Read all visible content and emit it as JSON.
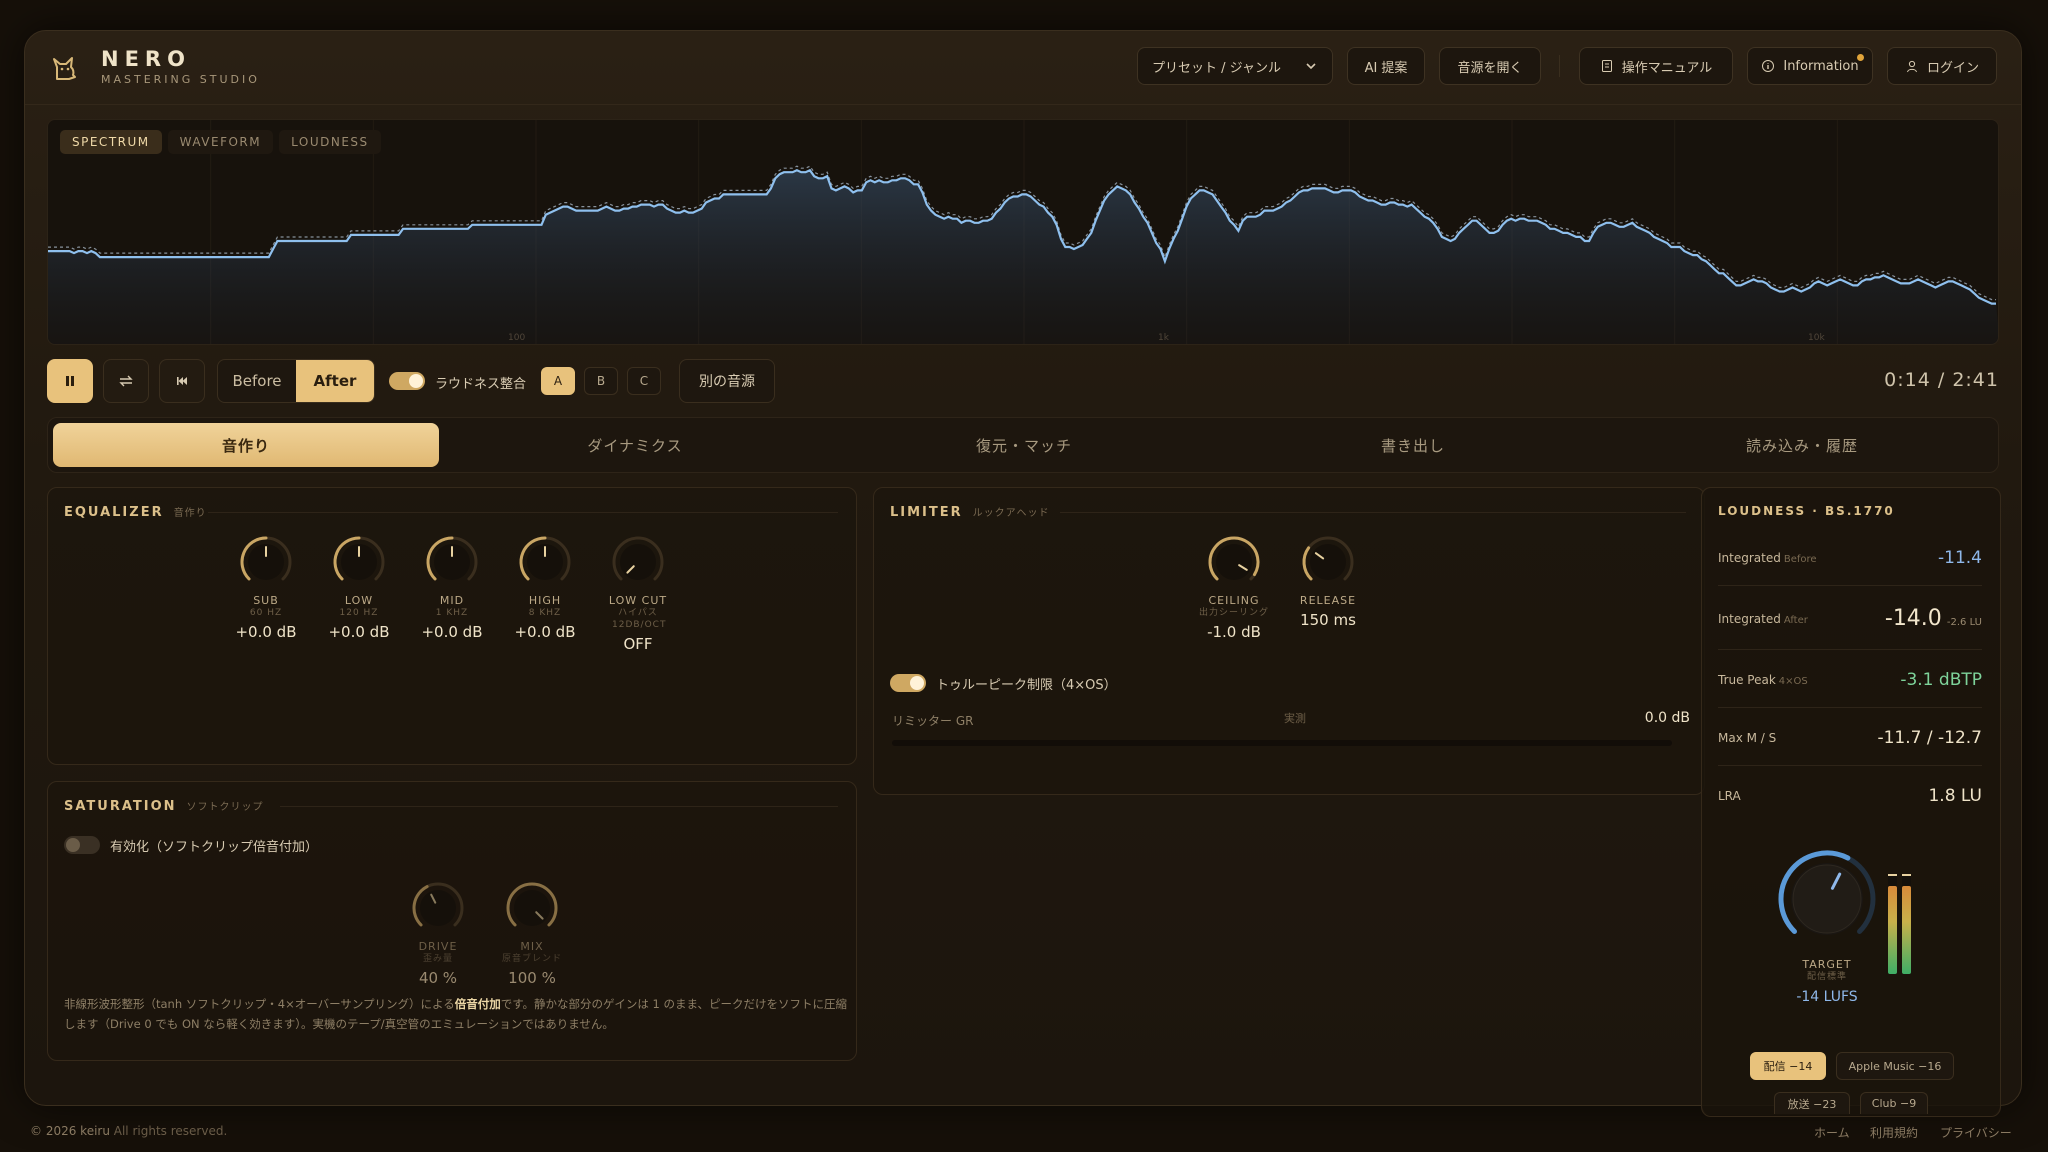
{
  "brand": {
    "title": "NERO",
    "subtitle": "MASTERING STUDIO"
  },
  "header": {
    "preset": "プリセット / ジャンル",
    "ai": "AI 提案",
    "open": "音源を開く",
    "manual": "操作マニュアル",
    "info": "Information",
    "login": "ログイン"
  },
  "spectrum": {
    "tabs": [
      "SPECTRUM",
      "WAVEFORM",
      "LOUDNESS"
    ],
    "active_tab": "SPECTRUM",
    "freq_labels": [
      "100",
      "1k",
      "10k"
    ]
  },
  "transport": {
    "before": "Before",
    "after": "After",
    "active": "After",
    "loudness_match": "ラウドネス整合",
    "loudness_match_on": true,
    "slots": [
      "A",
      "B",
      "C"
    ],
    "active_slot": "A",
    "alt_source": "別の音源",
    "time": "0:14 / 2:41"
  },
  "tabs": {
    "items": [
      "音作り",
      "ダイナミクス",
      "復元・マッチ",
      "書き出し",
      "読み込み・履歴"
    ],
    "active": "音作り"
  },
  "equalizer": {
    "title": "EQUALIZER",
    "subtitle": "音作り",
    "knobs": [
      {
        "name": "SUB",
        "sub": "60 HZ",
        "value": "+0.0 dB",
        "level": 0.5
      },
      {
        "name": "LOW",
        "sub": "120 HZ",
        "value": "+0.0 dB",
        "level": 0.5
      },
      {
        "name": "MID",
        "sub": "1 KHZ",
        "value": "+0.0 dB",
        "level": 0.5
      },
      {
        "name": "HIGH",
        "sub": "8 KHZ",
        "value": "+0.0 dB",
        "level": 0.5
      },
      {
        "name": "LOW CUT",
        "sub": "ハイパス 12DB/OCT",
        "value": "OFF",
        "level": 0.0
      }
    ]
  },
  "limiter": {
    "title": "LIMITER",
    "subtitle": "ルックアヘッド",
    "knobs": [
      {
        "name": "CEILING",
        "sub": "出力シーリング",
        "value": "-1.0 dB",
        "level": 0.95
      },
      {
        "name": "RELEASE",
        "sub": "",
        "value": "150 ms",
        "level": 0.3
      }
    ],
    "true_peak": "トゥルーピーク制限（4×OS）",
    "true_peak_on": true,
    "gr_label": "リミッター GR",
    "gr_mid": "実測",
    "gr_value": "0.0 dB"
  },
  "saturation": {
    "title": "SATURATION",
    "subtitle": "ソフトクリップ",
    "enable": "有効化（ソフトクリップ倍音付加）",
    "enabled": false,
    "knobs": [
      {
        "name": "DRIVE",
        "sub": "歪み量",
        "value": "40 %",
        "level": 0.4
      },
      {
        "name": "MIX",
        "sub": "原音ブレンド",
        "value": "100 %",
        "level": 1.0
      }
    ],
    "desc_pre": "非線形波形整形（tanh ソフトクリップ・4×オーバーサンプリング）による",
    "desc_bold": "倍音付加",
    "desc_post": "です。静かな部分のゲインは 1 のまま、ピークだけをソフトに圧縮します（Drive 0 でも ON なら軽く効きます）。実機のテープ/真空管のエミュレーションではありません。"
  },
  "loudness": {
    "title": "LOUDNESS · BS.1770",
    "rows": [
      {
        "key": "Integrated",
        "tag": "Before",
        "value": "-11.4",
        "unit": "",
        "color": "#8fb8ea"
      },
      {
        "key": "Integrated",
        "tag": "After",
        "value": "-14.0",
        "unit": "-2.6 LU",
        "color": "#f2e6cc"
      },
      {
        "key": "True Peak",
        "tag": "4×OS",
        "value": "-3.1 dBTP",
        "unit": "",
        "color": "#7ed39a"
      },
      {
        "key": "Max M / S",
        "tag": "",
        "value": "-11.7 / -12.7",
        "unit": "",
        "color": "#efe3c8"
      },
      {
        "key": "LRA",
        "tag": "",
        "value": "1.8 LU",
        "unit": "",
        "color": "#efe3c8"
      }
    ],
    "target_label": "TARGET",
    "target_sub": "配信標準",
    "target_value": "-14 LUFS",
    "target_level": 0.6,
    "meter_levels": [
      0.88,
      0.88
    ],
    "presets": [
      "配信 −14",
      "Apple Music −16",
      "放送 −23",
      "Club −9"
    ],
    "active_preset": "配信 −14"
  },
  "spectrum_after": [
    -58,
    -58,
    -58,
    -58,
    -58,
    -58,
    -59,
    -58,
    -58,
    -59,
    -58,
    -59,
    -61,
    -61,
    -61,
    -61,
    -61,
    -61,
    -61,
    -61,
    -61,
    -61,
    -61,
    -61,
    -61,
    -61,
    -61,
    -61,
    -61,
    -61,
    -61,
    -61,
    -61,
    -61,
    -61,
    -61,
    -61,
    -61,
    -61,
    -61,
    -61,
    -61,
    -61,
    -61,
    -61,
    -61,
    -61,
    -61,
    -61,
    -61,
    -61,
    -61,
    -57,
    -53,
    -53,
    -53,
    -53,
    -53,
    -53,
    -53,
    -53,
    -53,
    -53,
    -53,
    -53,
    -53,
    -53,
    -53,
    -53,
    -53,
    -50,
    -50,
    -50,
    -50,
    -50,
    -50,
    -50,
    -50,
    -50,
    -50,
    -50,
    -50,
    -47,
    -47,
    -47,
    -47,
    -47,
    -47,
    -47,
    -47,
    -47,
    -47,
    -47,
    -47,
    -47,
    -47,
    -47,
    -47,
    -45,
    -45,
    -45,
    -45,
    -45,
    -45,
    -45,
    -45,
    -45,
    -45,
    -45,
    -45,
    -45,
    -45,
    -45,
    -45,
    -45,
    -40,
    -39,
    -38,
    -37,
    -36,
    -36,
    -37,
    -38,
    -38,
    -38,
    -38,
    -38,
    -38,
    -37,
    -36,
    -37,
    -38,
    -38,
    -37,
    -37,
    -36,
    -36,
    -35,
    -35,
    -35,
    -36,
    -35,
    -35,
    -37,
    -38,
    -39,
    -39,
    -38,
    -39,
    -39,
    -38,
    -37,
    -34,
    -33,
    -32,
    -32,
    -30,
    -30,
    -30,
    -30,
    -30,
    -30,
    -30,
    -30,
    -30,
    -30,
    -30,
    -27,
    -22,
    -20,
    -19,
    -19,
    -19,
    -18,
    -19,
    -19,
    -18,
    -21,
    -22,
    -22,
    -21,
    -27,
    -28,
    -27,
    -26,
    -27,
    -29,
    -28,
    -28,
    -24,
    -23,
    -24,
    -23,
    -24,
    -24,
    -23,
    -23,
    -22,
    -22,
    -23,
    -25,
    -25,
    -29,
    -35,
    -38,
    -40,
    -41,
    -42,
    -41,
    -42,
    -42,
    -44,
    -43,
    -43,
    -44,
    -44,
    -43,
    -43,
    -42,
    -39,
    -37,
    -34,
    -32,
    -31,
    -31,
    -30,
    -30,
    -31,
    -33,
    -35,
    -36,
    -39,
    -41,
    -45,
    -52,
    -56,
    -56,
    -57,
    -56,
    -55,
    -52,
    -49,
    -43,
    -38,
    -33,
    -30,
    -28,
    -26,
    -27,
    -28,
    -30,
    -34,
    -37,
    -41,
    -44,
    -49,
    -54,
    -57,
    -63,
    -57,
    -52,
    -48,
    -42,
    -36,
    -32,
    -30,
    -28,
    -28,
    -29,
    -30,
    -33,
    -36,
    -39,
    -43,
    -45,
    -48,
    -43,
    -41,
    -41,
    -41,
    -40,
    -38,
    -38,
    -38,
    -37,
    -36,
    -34,
    -33,
    -31,
    -29,
    -28,
    -28,
    -27,
    -27,
    -27,
    -27,
    -28,
    -29,
    -29,
    -28,
    -28,
    -28,
    -29,
    -31,
    -32,
    -33,
    -33,
    -34,
    -35,
    -35,
    -34,
    -34,
    -35,
    -35,
    -36,
    -35,
    -37,
    -39,
    -41,
    -42,
    -44,
    -47,
    -51,
    -52,
    -53,
    -52,
    -49,
    -47,
    -45,
    -43,
    -43,
    -45,
    -47,
    -49,
    -49,
    -48,
    -45,
    -43,
    -42,
    -43,
    -42,
    -42,
    -43,
    -43,
    -43,
    -44,
    -45,
    -47,
    -47,
    -48,
    -49,
    -49,
    -50,
    -51,
    -51,
    -53,
    -53,
    -49,
    -46,
    -45,
    -44,
    -44,
    -45,
    -46,
    -46,
    -45,
    -44,
    -46,
    -47,
    -48,
    -49,
    -51,
    -52,
    -53,
    -54,
    -56,
    -56,
    -56,
    -58,
    -59,
    -60,
    -60,
    -62,
    -63,
    -65,
    -67,
    -69,
    -69,
    -71,
    -73,
    -75,
    -75,
    -74,
    -73,
    -72,
    -73,
    -73,
    -74,
    -76,
    -77,
    -78,
    -78,
    -77,
    -76,
    -77,
    -78,
    -77,
    -76,
    -74,
    -73,
    -74,
    -75,
    -74,
    -73,
    -72,
    -73,
    -74,
    -75,
    -75,
    -73,
    -72,
    -72,
    -71,
    -71,
    -70,
    -71,
    -72,
    -73,
    -74,
    -74,
    -74,
    -73,
    -72,
    -73,
    -74,
    -75,
    -76,
    -75,
    -74,
    -73,
    -73,
    -74,
    -75,
    -76,
    -77,
    -79,
    -81,
    -82,
    -83,
    -84,
    -84
  ]
}
